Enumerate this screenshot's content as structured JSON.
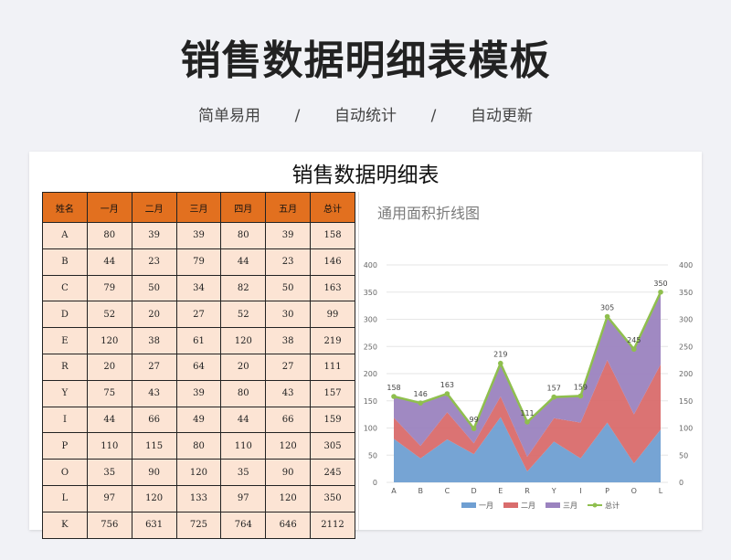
{
  "header": {
    "title": "销售数据明细表模板",
    "features": [
      "简单易用",
      "/",
      "自动统计",
      "/",
      "自动更新"
    ]
  },
  "sheet": {
    "title": "销售数据明细表",
    "columns": [
      "姓名",
      "一月",
      "二月",
      "三月",
      "四月",
      "五月",
      "总计"
    ],
    "rows": [
      [
        "A",
        "80",
        "39",
        "39",
        "80",
        "39",
        "158"
      ],
      [
        "B",
        "44",
        "23",
        "79",
        "44",
        "23",
        "146"
      ],
      [
        "C",
        "79",
        "50",
        "34",
        "82",
        "50",
        "163"
      ],
      [
        "D",
        "52",
        "20",
        "27",
        "52",
        "30",
        "99"
      ],
      [
        "E",
        "120",
        "38",
        "61",
        "120",
        "38",
        "219"
      ],
      [
        "R",
        "20",
        "27",
        "64",
        "20",
        "27",
        "111"
      ],
      [
        "Y",
        "75",
        "43",
        "39",
        "80",
        "43",
        "157"
      ],
      [
        "I",
        "44",
        "66",
        "49",
        "44",
        "66",
        "159"
      ],
      [
        "P",
        "110",
        "115",
        "80",
        "110",
        "120",
        "305"
      ],
      [
        "O",
        "35",
        "90",
        "120",
        "35",
        "90",
        "245"
      ],
      [
        "L",
        "97",
        "120",
        "133",
        "97",
        "120",
        "350"
      ],
      [
        "K",
        "756",
        "631",
        "725",
        "764",
        "646",
        "2112"
      ]
    ]
  },
  "chart_data": {
    "type": "area",
    "title": "通用面积折线图",
    "categories": [
      "A",
      "B",
      "C",
      "D",
      "E",
      "R",
      "Y",
      "I",
      "P",
      "O",
      "L"
    ],
    "ylim": [
      0,
      400
    ],
    "yticks": [
      0,
      50,
      100,
      150,
      200,
      250,
      300,
      350,
      400
    ],
    "grid": true,
    "legend_position": "bottom",
    "series": [
      {
        "name": "一月",
        "kind": "area",
        "color": "#6f9fd2",
        "values": [
          80,
          44,
          79,
          52,
          120,
          20,
          75,
          44,
          110,
          35,
          97
        ]
      },
      {
        "name": "二月",
        "kind": "area",
        "color": "#d96c6c",
        "values": [
          39,
          23,
          50,
          20,
          38,
          27,
          43,
          66,
          115,
          90,
          120
        ]
      },
      {
        "name": "三月",
        "kind": "area",
        "color": "#9b83bf",
        "values": [
          39,
          79,
          34,
          27,
          61,
          64,
          39,
          49,
          80,
          120,
          133
        ]
      },
      {
        "name": "总计",
        "kind": "line",
        "color": "#8fbf4e",
        "values": [
          158,
          146,
          163,
          99,
          219,
          111,
          157,
          159,
          305,
          245,
          350
        ]
      }
    ]
  }
}
